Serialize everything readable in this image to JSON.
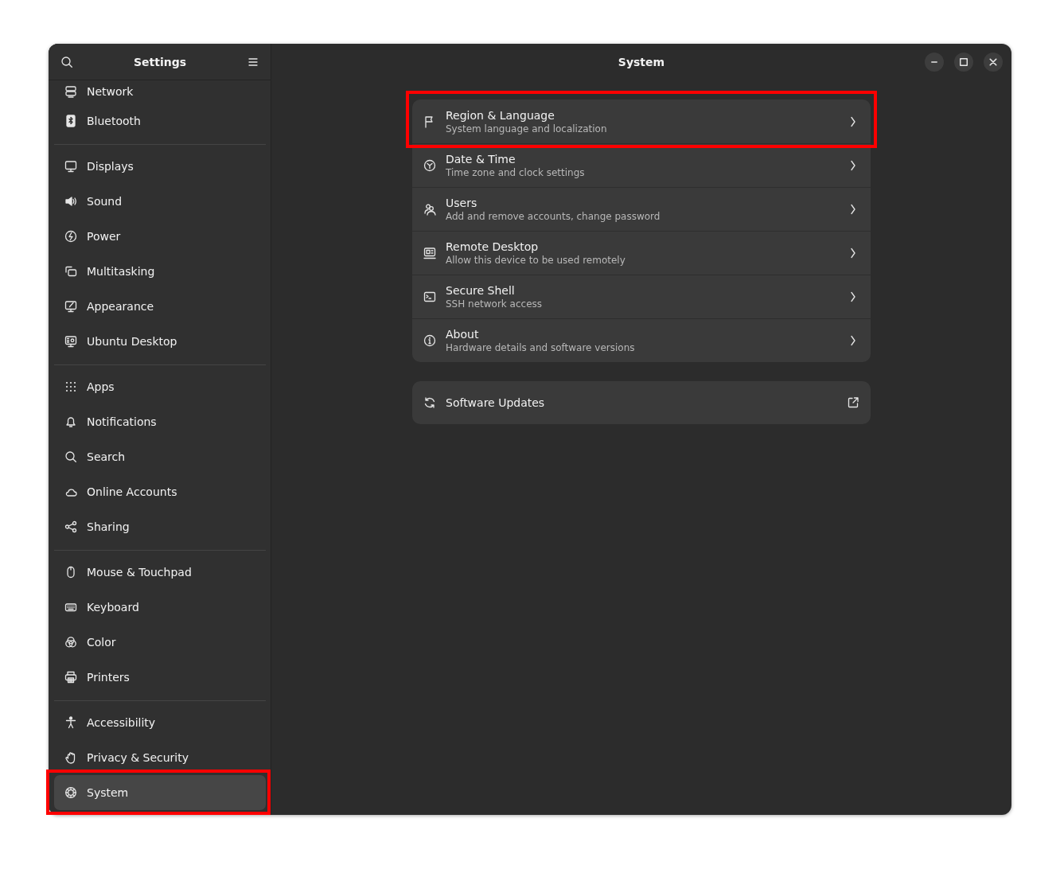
{
  "sidebar": {
    "title": "Settings",
    "groups": [
      {
        "items": [
          {
            "label": "Network",
            "selected": false,
            "highlighted": false
          },
          {
            "label": "Bluetooth",
            "selected": false,
            "highlighted": false
          }
        ]
      },
      {
        "items": [
          {
            "label": "Displays",
            "selected": false,
            "highlighted": false
          },
          {
            "label": "Sound",
            "selected": false,
            "highlighted": false
          },
          {
            "label": "Power",
            "selected": false,
            "highlighted": false
          },
          {
            "label": "Multitasking",
            "selected": false,
            "highlighted": false
          },
          {
            "label": "Appearance",
            "selected": false,
            "highlighted": false
          },
          {
            "label": "Ubuntu Desktop",
            "selected": false,
            "highlighted": false
          }
        ]
      },
      {
        "items": [
          {
            "label": "Apps",
            "selected": false,
            "highlighted": false
          },
          {
            "label": "Notifications",
            "selected": false,
            "highlighted": false
          },
          {
            "label": "Search",
            "selected": false,
            "highlighted": false
          },
          {
            "label": "Online Accounts",
            "selected": false,
            "highlighted": false
          },
          {
            "label": "Sharing",
            "selected": false,
            "highlighted": false
          }
        ]
      },
      {
        "items": [
          {
            "label": "Mouse & Touchpad",
            "selected": false,
            "highlighted": false
          },
          {
            "label": "Keyboard",
            "selected": false,
            "highlighted": false
          },
          {
            "label": "Color",
            "selected": false,
            "highlighted": false
          },
          {
            "label": "Printers",
            "selected": false,
            "highlighted": false
          }
        ]
      },
      {
        "items": [
          {
            "label": "Accessibility",
            "selected": false,
            "highlighted": false
          },
          {
            "label": "Privacy & Security",
            "selected": false,
            "highlighted": false
          },
          {
            "label": "System",
            "selected": true,
            "highlighted": true
          }
        ]
      }
    ]
  },
  "page": {
    "title": "System",
    "groups": [
      {
        "rows": [
          {
            "title": "Region & Language",
            "subtitle": "System language and localization",
            "kind": "navigate",
            "highlighted": true
          },
          {
            "title": "Date & Time",
            "subtitle": "Time zone and clock settings",
            "kind": "navigate",
            "highlighted": false
          },
          {
            "title": "Users",
            "subtitle": "Add and remove accounts, change password",
            "kind": "navigate",
            "highlighted": false
          },
          {
            "title": "Remote Desktop",
            "subtitle": "Allow this device to be used remotely",
            "kind": "navigate",
            "highlighted": false
          },
          {
            "title": "Secure Shell",
            "subtitle": "SSH network access",
            "kind": "navigate",
            "highlighted": false
          },
          {
            "title": "About",
            "subtitle": "Hardware details and software versions",
            "kind": "navigate",
            "highlighted": false
          }
        ]
      },
      {
        "rows": [
          {
            "title": "Software Updates",
            "kind": "external",
            "highlighted": false
          }
        ]
      }
    ]
  }
}
